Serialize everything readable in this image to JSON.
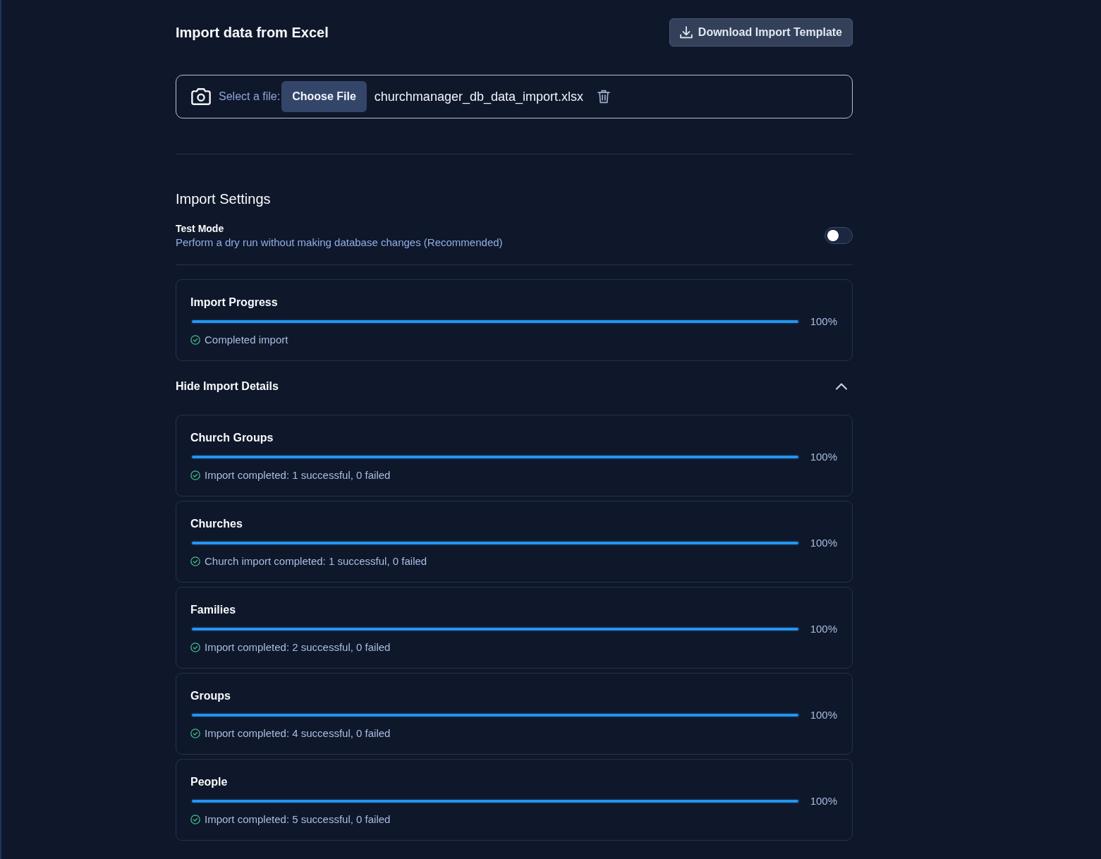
{
  "header": {
    "title": "Import data from Excel",
    "download_button": "Download Import Template"
  },
  "file_picker": {
    "label": "Select a file:",
    "button": "Choose File",
    "file_name": "churchmanager_db_data_import.xlsx"
  },
  "settings": {
    "title": "Import Settings",
    "options": [
      {
        "label": "Test Mode",
        "description": "Perform a dry run without making database changes (Recommended)",
        "on": false
      }
    ]
  },
  "progress": {
    "title": "Import Progress",
    "level": 1,
    "reading": "100%",
    "status": "Completed import"
  },
  "details": {
    "toggle_label": "Hide Import Details",
    "expanded": true,
    "items": [
      {
        "title": "Church Groups",
        "level": 1,
        "reading": "100%",
        "status": "Import completed: 1 successful, 0 failed"
      },
      {
        "title": "Churches",
        "level": 1,
        "reading": "100%",
        "status": "Church import completed: 1 successful, 0 failed"
      },
      {
        "title": "Families",
        "level": 1,
        "reading": "100%",
        "status": "Import completed: 2 successful, 0 failed"
      },
      {
        "title": "Groups",
        "level": 1,
        "reading": "100%",
        "status": "Import completed: 4 successful, 0 failed"
      },
      {
        "title": "People",
        "level": 1,
        "reading": "100%",
        "status": "Import completed: 5 successful, 0 failed"
      }
    ]
  }
}
